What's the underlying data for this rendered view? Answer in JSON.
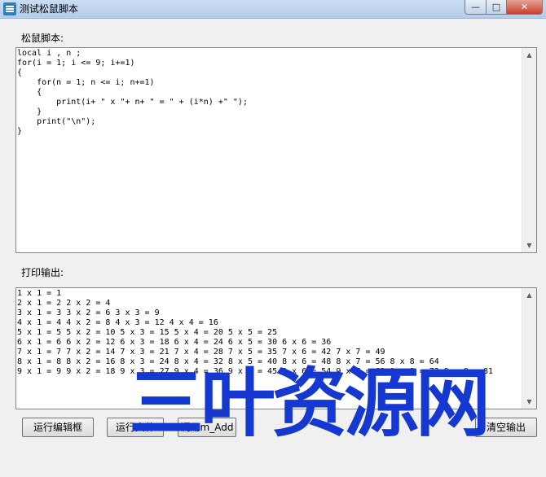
{
  "window": {
    "title": "测试松鼠脚本",
    "buttons": {
      "minimize": "—",
      "maximize": "□",
      "close": "✕"
    }
  },
  "script_section": {
    "label": "松鼠脚本:",
    "code": "local i , n ;\nfor(i = 1; i <= 9; i+=1)\n{\n    for(n = 1; n <= i; n+=1)\n    {\n        print(i+ \" x \"+ n+ \" = \" + (i*n) +\" \");\n    }\n    print(\"\\n\");\n}"
  },
  "output_section": {
    "label": "打印输出:",
    "text": "1 x 1 = 1\n2 x 1 = 2 2 x 2 = 4\n3 x 1 = 3 3 x 2 = 6 3 x 3 = 9\n4 x 1 = 4 4 x 2 = 8 4 x 3 = 12 4 x 4 = 16\n5 x 1 = 5 5 x 2 = 10 5 x 3 = 15 5 x 4 = 20 5 x 5 = 25\n6 x 1 = 6 6 x 2 = 12 6 x 3 = 18 6 x 4 = 24 6 x 5 = 30 6 x 6 = 36\n7 x 1 = 7 7 x 2 = 14 7 x 3 = 21 7 x 4 = 28 7 x 5 = 35 7 x 6 = 42 7 x 7 = 49\n8 x 1 = 8 8 x 2 = 16 8 x 3 = 24 8 x 4 = 32 8 x 5 = 40 8 x 6 = 48 8 x 7 = 56 8 x 8 = 64\n9 x 1 = 9 9 x 2 = 18 9 x 3 = 27 9 x 4 = 36 9 x 5 = 45 9 x 6 = 54 9 x 7 = 63 9 x 8 = 72 9 x 9 = 81"
  },
  "buttons": {
    "run_editor": "运行编辑框",
    "run_file": "运行文件",
    "call_add": "调用m_Add",
    "clear_output": "清空输出"
  },
  "watermark": "三叶资源网"
}
